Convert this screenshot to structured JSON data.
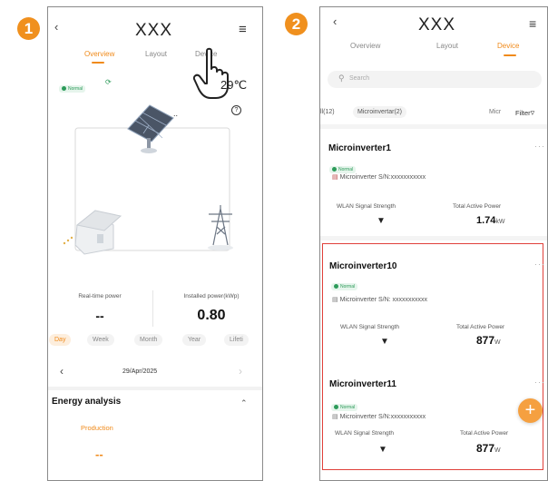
{
  "steps": [
    "1",
    "2"
  ],
  "screen1": {
    "title": "XXX",
    "tabs": [
      "Overview",
      "Layout",
      "Device"
    ],
    "status": "Normal",
    "temperature": "29℃",
    "realtime_power_label": "Real-time power",
    "installed_power_label": "Installed power(kWp)",
    "realtime_power_value": "--",
    "installed_power_value": "0.80",
    "periods": [
      "Day",
      "Week",
      "Month",
      "Year",
      "Lifeti"
    ],
    "date": "29/Apr/2025",
    "energy_title": "Energy analysis",
    "production_label": "Production",
    "production_value": "--"
  },
  "screen2": {
    "title": "XXX",
    "tabs": [
      "Overview",
      "Layout",
      "Device"
    ],
    "search_placeholder": "Search",
    "filters": [
      "ll(12)",
      "Microinvertar(2)"
    ],
    "filter_truncated": "Micr",
    "filter_button": "Filter",
    "devices": [
      {
        "name": "Microinverter1",
        "status": "Normal",
        "sn": "Microinverter S/N:xxxxxxxxxxx",
        "wlan_label": "WLAN Signal Strength",
        "power_label": "Total Active Power",
        "power_value": "1.74",
        "power_unit": "kW"
      },
      {
        "name": "Microinverter10",
        "status": "Normal",
        "sn": "Microinverter S/N: xxxxxxxxxxx",
        "wlan_label": "WLAN Signal Strength",
        "power_label": "Total Active Power",
        "power_value": "877",
        "power_unit": "W"
      },
      {
        "name": "Microinverter11",
        "status": "Normal",
        "sn": "Microinverter S/N:xxxxxxxxxxx",
        "wlan_label": "WLAN Signal Strength",
        "power_label": "Total Active Power",
        "power_value": "877",
        "power_unit": "W"
      }
    ]
  },
  "colors": {
    "accent": "#f08a1a",
    "normal": "#2d9b5a",
    "highlight": "#e0403a"
  }
}
